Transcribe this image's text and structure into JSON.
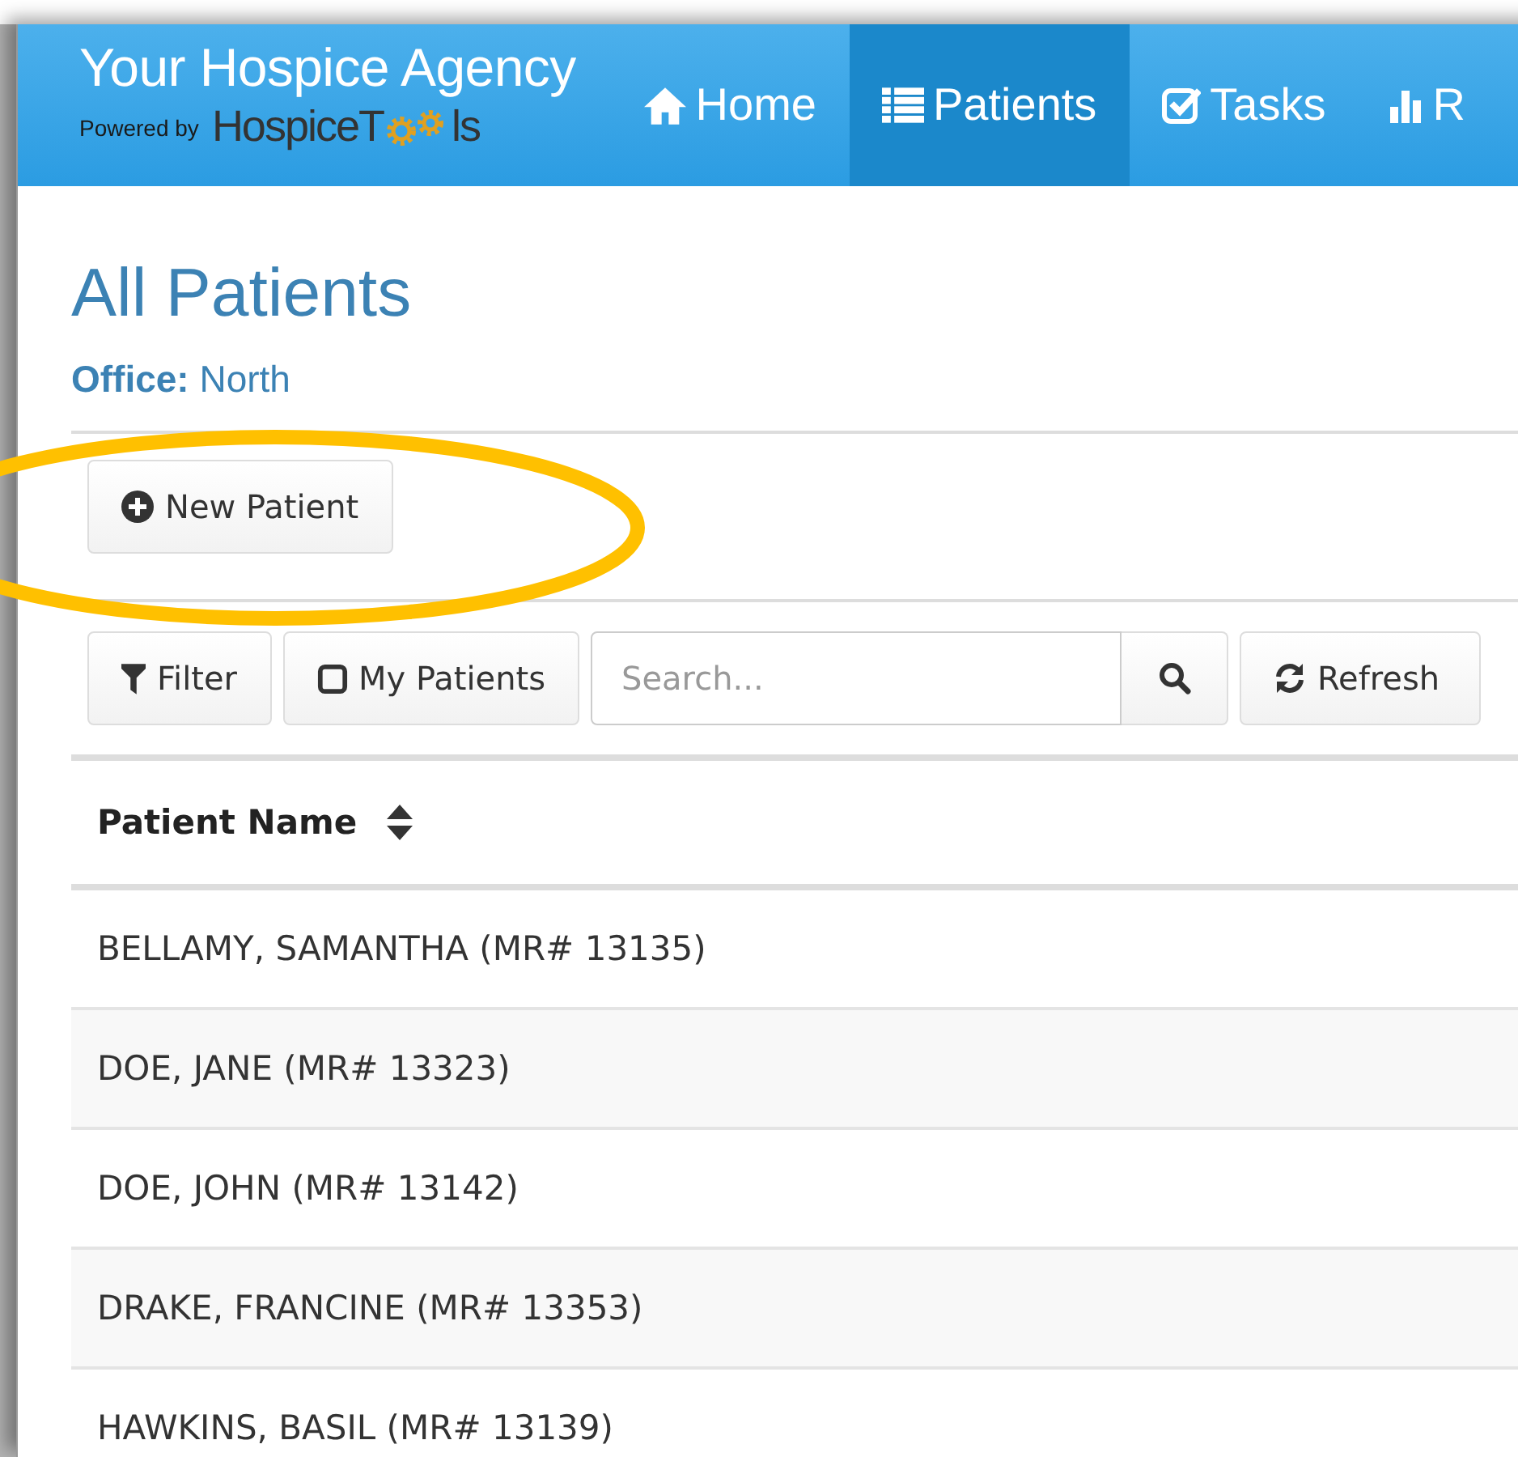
{
  "brand": {
    "title": "Your Hospice Agency",
    "powered_by": "Powered by",
    "logo_before_gears": "HospiceT",
    "logo_after_gears": "ls"
  },
  "nav": [
    {
      "kind": "home",
      "label": "Home",
      "selected": false
    },
    {
      "kind": "list",
      "label": "Patients",
      "selected": true
    },
    {
      "kind": "check",
      "label": "Tasks",
      "selected": false
    },
    {
      "kind": "chart",
      "label": "R",
      "selected": false
    }
  ],
  "page": {
    "title": "All Patients",
    "office": "**Office:** North"
  },
  "new_button": "New Patient",
  "toolbar": {
    "filter": "Filter",
    "my_patients": {
      "label": "My Patients",
      "checked": false
    },
    "search": {
      "placeholder": "Search..."
    },
    "refresh": "Refresh"
  },
  "table": {
    "columns": [
      {
        "label": "Patient Name"
      }
    ],
    "rows": [
      "BELLAMY, SAMANTHA (MR# 13135)",
      "DOE, JANE (MR# 13323)",
      "DOE, JOHN (MR# 13142)",
      "DRAKE, FRANCINE (MR# 13353)",
      "HAWKINS, BASIL (MR# 13139)"
    ]
  }
}
